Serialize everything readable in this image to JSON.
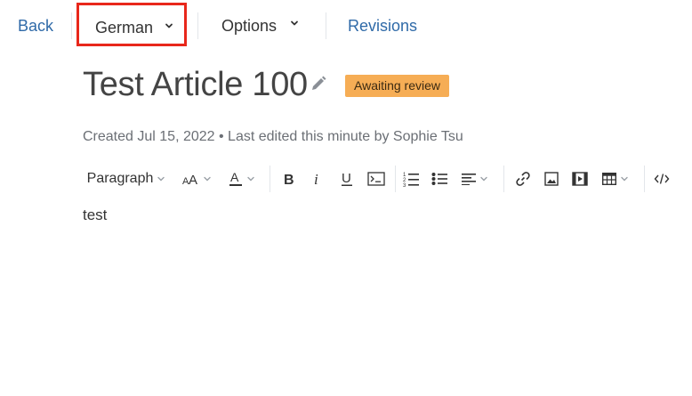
{
  "nav": {
    "back_label": "Back",
    "language_label": "German",
    "options_label": "Options",
    "revisions_label": "Revisions"
  },
  "article": {
    "title": "Test Article 100",
    "status_badge": "Awaiting review",
    "meta": "Created Jul 15, 2022 • Last edited this minute by Sophie Tsu",
    "body_text": "test"
  },
  "toolbar": {
    "paragraph_label": "Paragraph",
    "tools": [
      "font-size-icon",
      "text-color-icon",
      "bold-icon",
      "italic-icon",
      "underline-icon",
      "code-block-icon",
      "ordered-list-icon",
      "bullet-list-icon",
      "align-icon",
      "link-icon",
      "image-icon",
      "video-icon",
      "table-icon",
      "source-code-icon"
    ]
  },
  "colors": {
    "link": "#2f6aa8",
    "highlight_border": "#e8271b",
    "badge_bg": "#f6ad55"
  }
}
